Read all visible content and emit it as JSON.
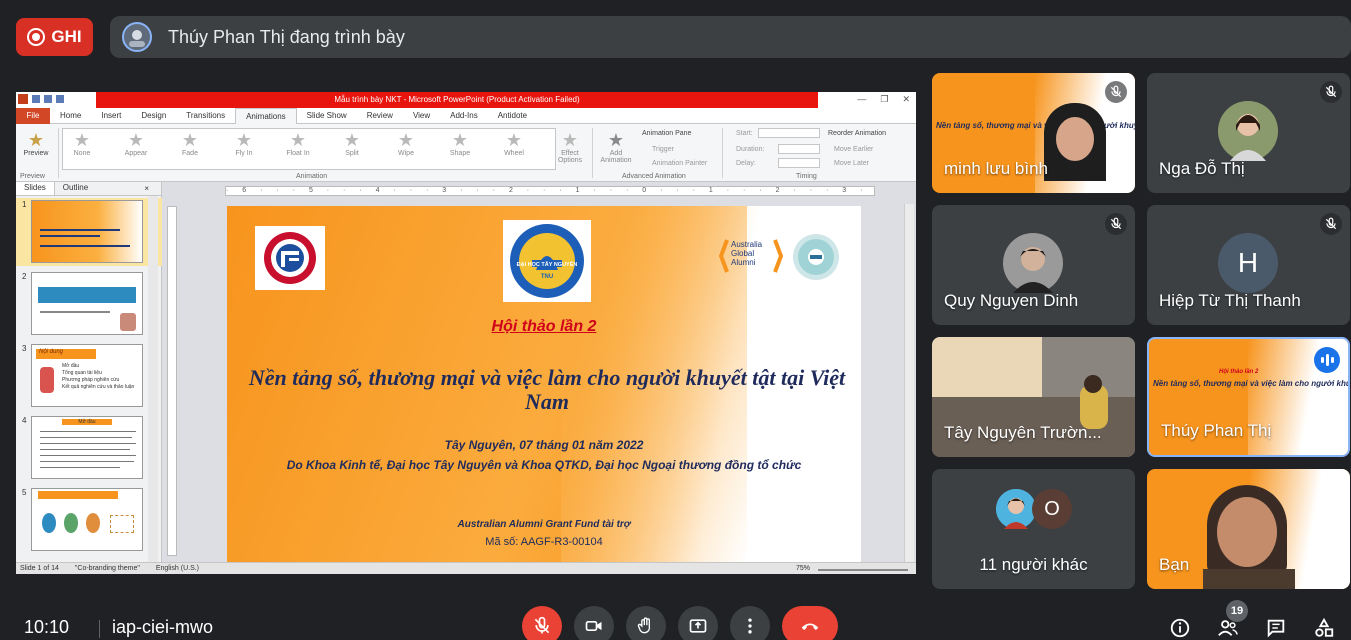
{
  "recording": {
    "label": "GHI"
  },
  "presenting": {
    "text": "Thúy Phan Thị đang trình bày"
  },
  "powerpoint": {
    "window_title": "Mẫu trình bày NKT  -  Microsoft PowerPoint (Product Activation Failed)",
    "tabs": [
      "File",
      "Home",
      "Insert",
      "Design",
      "Transitions",
      "Animations",
      "Slide Show",
      "Review",
      "View",
      "Add-Ins",
      "Antidote"
    ],
    "active_tab": "Animations",
    "ribbon": {
      "preview": "Preview",
      "effects": [
        "None",
        "Appear",
        "Fade",
        "Fly In",
        "Float In",
        "Split",
        "Wipe",
        "Shape",
        "Wheel"
      ],
      "effect_options": "Effect Options",
      "add_animation": "Add Animation",
      "animation_pane": "Animation Pane",
      "trigger": "Trigger",
      "animation_painter": "Animation Painter",
      "start": "Start:",
      "duration": "Duration:",
      "delay": "Delay:",
      "reorder": "Reorder Animation",
      "move_earlier": "Move Earlier",
      "move_later": "Move Later",
      "group_preview": "Preview",
      "group_animation": "Animation",
      "group_advanced": "Advanced Animation",
      "group_timing": "Timing"
    },
    "sidebar": {
      "tab_slides": "Slides",
      "tab_outline": "Outline",
      "close": "×",
      "thumbs": [
        "1",
        "2",
        "3",
        "4",
        "5"
      ],
      "thumb3_title": "Nội dung",
      "thumb3_items": [
        "Mở đầu",
        "Tổng quan tài liệu",
        "Phương pháp nghiên cứu",
        "Kết quả nghiên cứu và thảo luận"
      ],
      "thumb4_title": "Mở đầu"
    },
    "ruler": "· 6 · · · 5 · · · 4 · · · 3 · · · 2 · · · 1 · · · 0 · · · 1 · · · 2 · · · 3 · · · 4 · · · 5 · · · 6 ·",
    "slide": {
      "subtitle": "Hội thảo lần 2",
      "title": "Nền tảng số, thương mại và việc làm cho người khuyết tật tại Việt Nam",
      "date": "Tây Nguyên, 07 tháng 01 năm 2022",
      "organizers": "Do Khoa Kinh tế, Đại học Tây Nguyên và Khoa QTKD, Đại học Ngoại thương đồng tổ chức",
      "fund": "Australian  Alumni  Grant Fund tài trợ",
      "code": "Mã số: AAGF-R3-00104",
      "logo_left": "FTU",
      "logo_center_name": "ĐẠI HỌC TÂY NGUYÊN",
      "logo_center_abbr": "TNU",
      "logo_right": "Australia Global Alumni"
    },
    "status": {
      "slide_of": "Slide 1 of 14",
      "theme": "\"Co-branding theme\"",
      "language": "English (U.S.)",
      "zoom": "75%"
    }
  },
  "participants": [
    {
      "name": "minh lưu bình",
      "muted": true,
      "type": "video"
    },
    {
      "name": "Nga Đỗ Thị",
      "muted": true,
      "type": "avatar"
    },
    {
      "name": "Quy Nguyen Dinh",
      "muted": true,
      "type": "avatar"
    },
    {
      "name": "Hiệp Từ Thị Thanh",
      "muted": true,
      "type": "initial",
      "initial": "H"
    },
    {
      "name": "Tây Nguyên Trườn...",
      "muted": false,
      "type": "video"
    },
    {
      "name": "Thúy Phan Thị",
      "muted": false,
      "type": "video",
      "speaking": true
    },
    {
      "name": "11 người khác",
      "type": "others",
      "initial": "O"
    },
    {
      "name": "Bạn",
      "type": "self"
    }
  ],
  "tile_slide_text": {
    "heading": "Hội thảo lần 2",
    "title": "Nền tảng số, thương mại và việc làm cho người khuyết tật tại Việt Nam"
  },
  "bottom": {
    "time": "10:10",
    "meeting_code": "iap-ciei-mwo",
    "participants_count": "19"
  },
  "colors": {
    "background": "#202124",
    "record_red": "#d93025",
    "slide_orange": "#f7941d",
    "end_call_red": "#ea4335",
    "speaking_blue": "#1a73e8"
  }
}
